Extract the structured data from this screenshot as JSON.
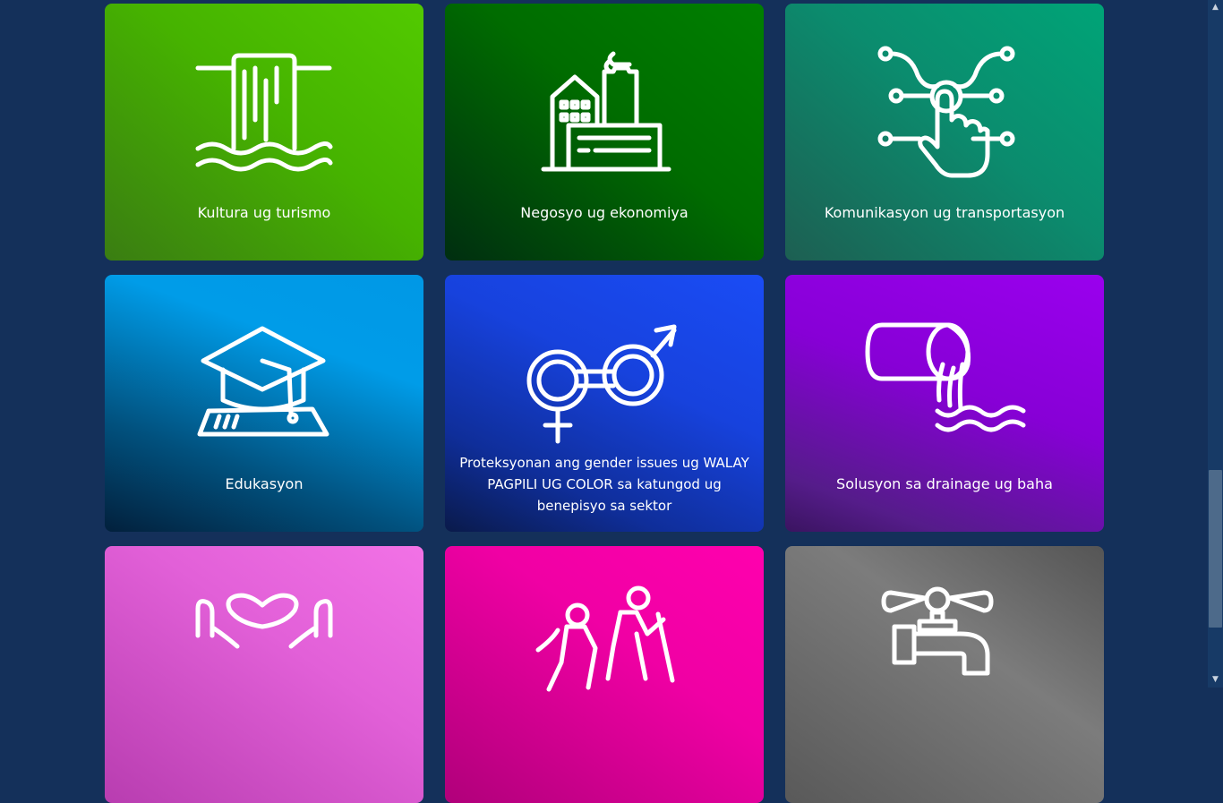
{
  "cards": [
    {
      "label": "Kultura ug turismo",
      "icon": "waterfall-icon",
      "color": "#46b300"
    },
    {
      "label": "Negosyo ug ekonomiya",
      "icon": "factory-icon",
      "color": "#006c00"
    },
    {
      "label": "Komunikasyon ug transportasyon",
      "icon": "touch-network-icon",
      "color": "#0b8c6e"
    },
    {
      "label": "Edukasyon",
      "icon": "graduation-cap-icon",
      "color": "#009ce8"
    },
    {
      "label": "Proteksyonan ang gender issues ug WALAY PAGPILI UG COLOR sa katungod ug benepisyo sa sektor",
      "icon": "gender-equality-icon",
      "color": "#1742dd"
    },
    {
      "label": "Solusyon sa drainage ug baha",
      "icon": "drainage-pipe-icon",
      "color": "#8700d6"
    },
    {
      "label": "",
      "icon": "heart-hands-icon",
      "color": "#e260d8"
    },
    {
      "label": "",
      "icon": "hikers-icon",
      "color": "#f000a4"
    },
    {
      "label": "",
      "icon": "water-faucet-icon",
      "color": "#7c7c7c"
    }
  ],
  "scrollbar": {
    "up_arrow": "▲",
    "down_arrow": "▼"
  }
}
